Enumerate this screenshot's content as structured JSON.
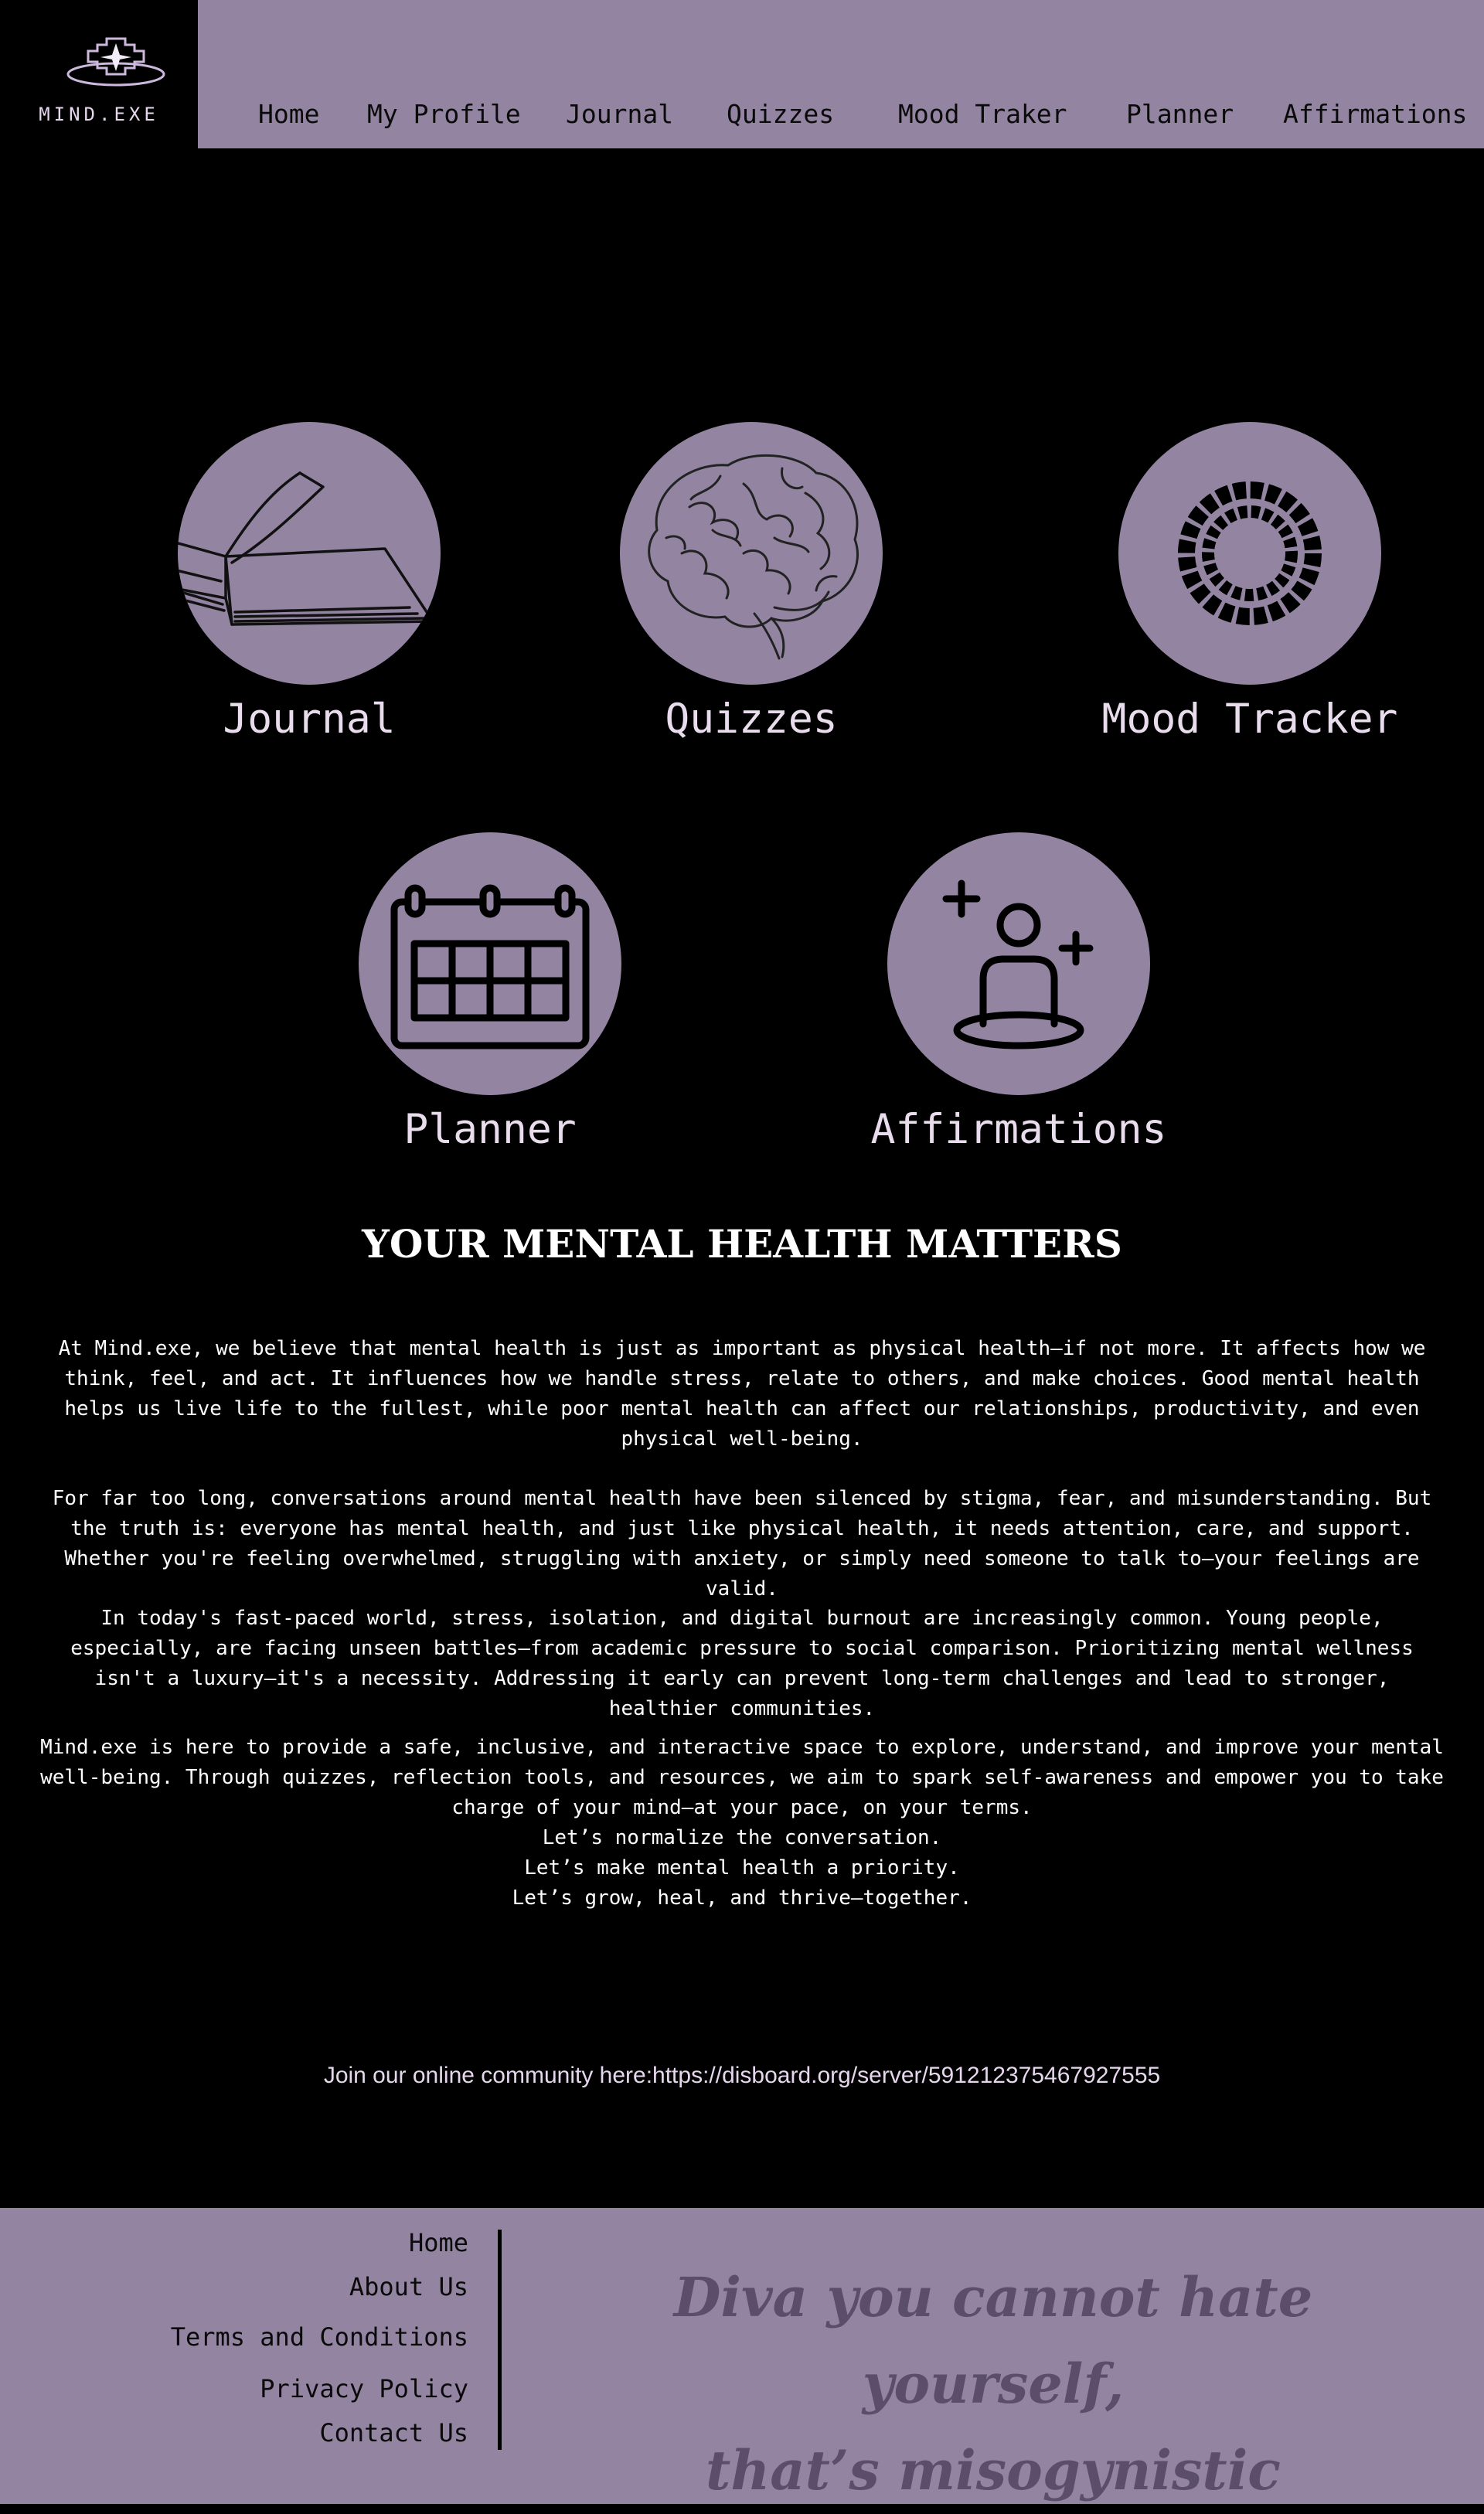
{
  "colors": {
    "background": "#000000",
    "accent": "#9385a2",
    "nav_text": "#0a0a0a",
    "label_text": "#e9dcec",
    "quote_text": "#5a4e6b"
  },
  "logo": {
    "text": "MIND.EXE",
    "icon": "pixel-star-logo-icon"
  },
  "nav": {
    "items": [
      {
        "label": "Home"
      },
      {
        "label": "My Profile"
      },
      {
        "label": "Journal"
      },
      {
        "label": "Quizzes"
      },
      {
        "label": "Mood Traker"
      },
      {
        "label": "Planner"
      },
      {
        "label": "Affirmations"
      }
    ]
  },
  "features": [
    {
      "label": "Journal",
      "icon": "open-book-icon"
    },
    {
      "label": "Quizzes",
      "icon": "brain-icon"
    },
    {
      "label": "Mood Tracker",
      "icon": "ring-dial-icon"
    },
    {
      "label": "Planner",
      "icon": "calendar-icon"
    },
    {
      "label": "Affirmations",
      "icon": "person-plus-icon"
    }
  ],
  "article": {
    "heading": "YOUR MENTAL HEALTH MATTERS",
    "paragraphs": [
      "At Mind.exe, we believe that mental health is just as important as physical health—if not more. It affects how we think, feel, and act. It influences how we handle stress, relate to others, and make choices. Good mental health helps us live life to the fullest, while poor mental health can affect our relationships, productivity, and even physical well-being.",
      "For far too long, conversations around mental health have been silenced by stigma, fear, and misunderstanding. But the truth is: everyone has mental health, and just like physical health, it needs attention, care, and support. Whether you're feeling overwhelmed, struggling with anxiety, or simply need someone to talk to—your feelings are valid.",
      "In today's fast-paced world, stress, isolation, and digital burnout are increasingly common. Young people, especially, are facing unseen battles—from academic pressure to social comparison. Prioritizing mental wellness isn't a luxury—it's a necessity. Addressing it early can prevent long-term challenges and lead to stronger, healthier communities.",
      "Mind.exe is here to provide a safe, inclusive, and interactive space to explore, understand, and improve your mental well-being. Through quizzes, reflection tools, and resources, we aim to spark self-awareness and empower you to take charge of your mind—at your pace, on your terms."
    ],
    "closing_lines": [
      "Let’s normalize the conversation.",
      "Let’s make mental health a priority.",
      "Let’s grow, heal, and thrive—together."
    ]
  },
  "community": {
    "text": "Join our online community here:https://disboard.org/server/591212375467927555"
  },
  "footer": {
    "links": [
      {
        "label": "Home"
      },
      {
        "label": "About Us"
      },
      {
        "label": "Terms and Conditions"
      },
      {
        "label": "Privacy Policy"
      },
      {
        "label": "Contact Us"
      }
    ],
    "quote_lines": [
      "Diva you cannot hate yourself,",
      "that’s misogynistic"
    ]
  }
}
